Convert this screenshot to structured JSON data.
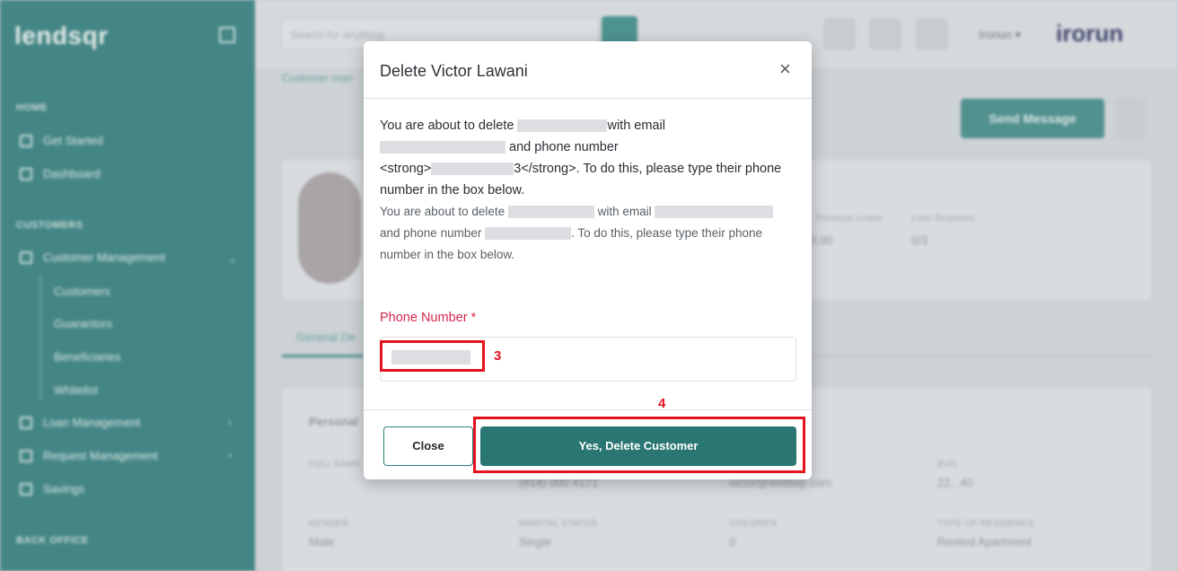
{
  "sidebar": {
    "logo": "lendsqr",
    "sections": [
      "HOME",
      "CUSTOMERS",
      "BACK OFFICE"
    ],
    "items": [
      {
        "label": "Get Started"
      },
      {
        "label": "Dashboard"
      },
      {
        "label": "Customer Management"
      },
      {
        "label": "Loan Management"
      },
      {
        "label": "Request Management"
      },
      {
        "label": "Savings"
      }
    ],
    "sub_items": [
      "Customers",
      "Guarantors",
      "Beneficiaries",
      "Whitelist"
    ]
  },
  "topbar": {
    "search_placeholder": "Search for anything",
    "user": "Ironun",
    "brand": "irorun"
  },
  "page": {
    "breadcrumb": "Customer man",
    "send_message": "Send Message"
  },
  "profile": {
    "previous_loans_label": "Previous Loans",
    "previous_loans_value": "0.00",
    "loan_requests_label": "Loan Requests",
    "loan_requests_value": "0/3"
  },
  "tabs": {
    "active": "General De"
  },
  "info": {
    "section_title": "Personal",
    "fields": [
      {
        "label": "FULL NAME",
        "value": "..."
      },
      {
        "label": "",
        "value": "(814) 000 4171"
      },
      {
        "label": "",
        "value": "victor@lendsqr.com"
      },
      {
        "label": "BVN",
        "value": "22...40"
      },
      {
        "label": "GENDER",
        "value": "Male"
      },
      {
        "label": "MARITAL STATUS",
        "value": "Single"
      },
      {
        "label": "CHILDREN",
        "value": "0"
      },
      {
        "label": "TYPE OF RESIDENCE",
        "value": "Rented Apartment"
      }
    ]
  },
  "modal": {
    "title": "Delete Victor Lawani",
    "close_symbol": "×",
    "body1_a": "You are about to delete ",
    "body1_b": "with email",
    "body1_c": " and phone number",
    "body1_d": "<strong>",
    "body1_e": "3</strong>. To do this, please type their phone number in the box below.",
    "body2_a": "You are about to delete ",
    "body2_b": " with email ",
    "body2_c": "and phone number ",
    "body2_d": ". To do this, please type their phone number in the box below.",
    "phone_label": "Phone Number *",
    "close_button": "Close",
    "delete_button": "Yes, Delete Customer"
  },
  "annotations": {
    "step3": "3",
    "step4": "4",
    "color": "#e3131e"
  }
}
